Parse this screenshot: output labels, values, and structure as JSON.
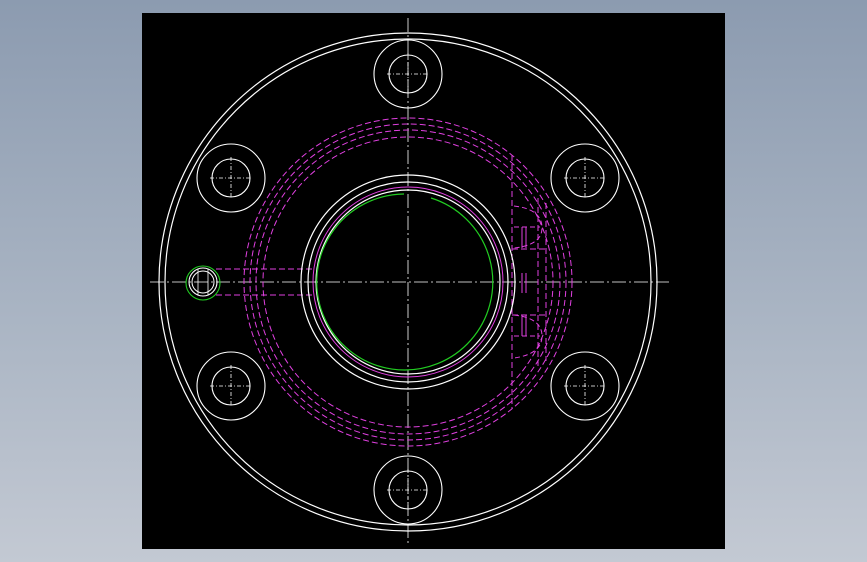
{
  "drawing": {
    "name": "flange-drawing",
    "colors": {
      "background": "#000000",
      "outline": "#ffffff",
      "hidden": "#e040e0",
      "bore": "#22cc22"
    },
    "bolt_hole_count": 6
  }
}
